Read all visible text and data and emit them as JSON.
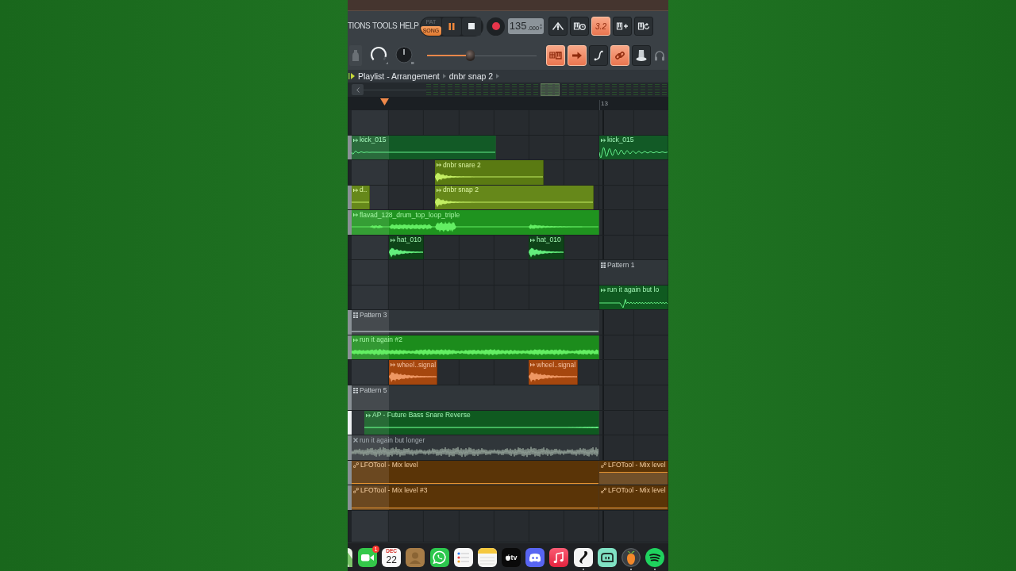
{
  "menu": [
    {
      "label": "TIONS"
    },
    {
      "label": "TOOLS"
    },
    {
      "label": "HELP"
    }
  ],
  "transport": {
    "modes": [
      {
        "label": "PAT",
        "selected": false
      },
      {
        "label": "SONG",
        "selected": true
      }
    ],
    "buttons": [
      {
        "kind": "pause",
        "on": true
      },
      {
        "kind": "stop",
        "on": false
      },
      {
        "kind": "record",
        "on": false
      }
    ],
    "tempo": {
      "value": "135",
      "decimals": ".000"
    }
  },
  "tools": {
    "top": [
      {
        "kind": "metronome",
        "on": false
      },
      {
        "kind": "wait",
        "on": false
      },
      {
        "kind": "countdown",
        "label": "3.2",
        "on": true
      },
      {
        "kind": "overdub",
        "on": false
      },
      {
        "kind": "loop",
        "on": false
      }
    ],
    "bottom": [
      {
        "kind": "stepedit",
        "on": true
      },
      {
        "kind": "arrow",
        "on": true
      },
      {
        "kind": "curve",
        "on": false
      },
      {
        "kind": "link",
        "on": true
      },
      {
        "kind": "hat",
        "on": false
      }
    ]
  },
  "mixer": {
    "knobs": [
      {
        "kind": "ring"
      },
      {
        "kind": "dial"
      }
    ],
    "slider": {
      "level": 0.39
    }
  },
  "playlist": {
    "title": "Playlist - Arrangement",
    "crumbs": [
      {
        "label": "dnbr snap 2"
      }
    ],
    "ruler": {
      "bar": "13"
    },
    "tracks": [
      {
        "selected": false
      },
      {
        "selected": false,
        "clips": [
          {
            "kind": "audio",
            "name": "kick_015",
            "color": "#125a26",
            "muted": false
          },
          {
            "kind": "audio",
            "name": "kick_015",
            "color": "#125a26",
            "muted": false
          }
        ]
      },
      {
        "selected": false,
        "clips": [
          {
            "kind": "audio",
            "name": "dnbr snare 2",
            "color": "#5a7a12",
            "muted": false
          }
        ]
      },
      {
        "selected": false,
        "clips": [
          {
            "kind": "audio",
            "name": "d..",
            "color": "#66881a",
            "muted": false
          },
          {
            "kind": "audio",
            "name": "dnbr snap 2",
            "color": "#66881a",
            "muted": false
          }
        ]
      },
      {
        "selected": false,
        "clips": [
          {
            "kind": "audio",
            "name": "flavad_128_drum_top_loop_triple",
            "color": "#1f931f",
            "muted": false
          }
        ]
      },
      {
        "selected": false,
        "clips": [
          {
            "kind": "audio",
            "name": "hat_010",
            "color": "#0e4418",
            "muted": false
          },
          {
            "kind": "audio",
            "name": "hat_010",
            "color": "#0e4418",
            "muted": false
          }
        ]
      },
      {
        "selected": false,
        "clips": [
          {
            "kind": "pattern",
            "name": "Pattern 1",
            "color": "#30363a",
            "muted": false
          }
        ]
      },
      {
        "selected": false,
        "clips": [
          {
            "kind": "audio",
            "name": "run it again but lo",
            "color": "#0f5a20",
            "muted": false
          }
        ]
      },
      {
        "selected": false,
        "clips": [
          {
            "kind": "pattern",
            "name": "Pattern 3",
            "color": "#30363a",
            "muted": false
          }
        ]
      },
      {
        "selected": false,
        "clips": [
          {
            "kind": "audio",
            "name": "run it again #2",
            "color": "#1c8c1c",
            "muted": false
          }
        ]
      },
      {
        "selected": false,
        "clips": [
          {
            "kind": "audio",
            "name": "wheel..signal",
            "color": "#a6470e",
            "muted": false
          },
          {
            "kind": "audio",
            "name": "wheel..signal",
            "color": "#a6470e",
            "muted": false
          }
        ]
      },
      {
        "selected": false,
        "clips": [
          {
            "kind": "pattern",
            "name": "Pattern 5",
            "color": "#30363a",
            "muted": false
          }
        ]
      },
      {
        "selected": true,
        "clips": [
          {
            "kind": "audio",
            "name": "AP - Future Bass Snare Reverse",
            "color": "#0f5a20",
            "muted": false
          }
        ]
      },
      {
        "selected": false,
        "clips": [
          {
            "kind": "audio",
            "name": "run it again but longer",
            "muted": true
          }
        ]
      },
      {
        "selected": false,
        "clips": [
          {
            "kind": "automation",
            "name": "LFOTool - Mix level",
            "color": "#5a3407",
            "muted": false
          },
          {
            "kind": "automation",
            "name": "LFOTool - Mix level",
            "color": "#5a3407",
            "muted": false
          }
        ]
      },
      {
        "selected": false,
        "clips": [
          {
            "kind": "automation",
            "name": "LFOTool - Mix level #3",
            "color": "#5a3407",
            "muted": false
          },
          {
            "kind": "automation",
            "name": "LFOTool - Mix level",
            "color": "#5a3407",
            "muted": false
          }
        ]
      },
      {
        "selected": false
      }
    ]
  },
  "dock": {
    "apps": [
      {
        "kind": "map",
        "running": false
      },
      {
        "kind": "video",
        "badge": "1",
        "running": false
      },
      {
        "kind": "calendar",
        "month": "DEC",
        "day": "22",
        "running": false
      },
      {
        "kind": "contact",
        "running": false
      },
      {
        "kind": "chat",
        "running": false
      },
      {
        "kind": "list",
        "running": false
      },
      {
        "kind": "notes",
        "running": false
      },
      {
        "kind": "tv",
        "label": "tv",
        "running": false
      },
      {
        "kind": "controller",
        "running": false
      },
      {
        "kind": "music",
        "running": false
      },
      {
        "kind": "slash",
        "running": true
      },
      {
        "kind": "robot",
        "running": false
      },
      {
        "kind": "fruit",
        "running": true
      },
      {
        "kind": "waves",
        "running": true
      }
    ]
  }
}
